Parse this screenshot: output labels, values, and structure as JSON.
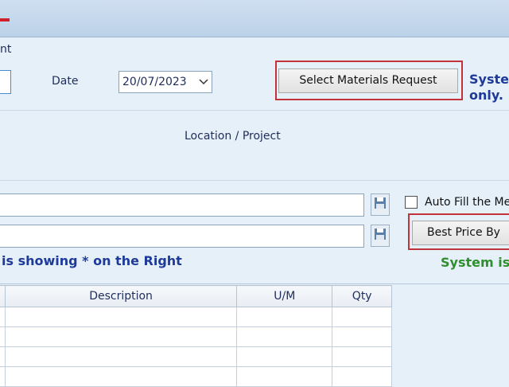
{
  "header_text": {
    "partial_label": "nt",
    "date_label": "Date",
    "date_value": "20/07/2023",
    "select_materials_button": "Select Materials Request",
    "system_note_line1": "Syste",
    "system_note_line2": "only."
  },
  "location": {
    "label": "Location / Project"
  },
  "fields": {
    "auto_fill_label": "Auto Fill the Me",
    "best_price_button": "Best Price By",
    "showing_note": "is showing * on the Right",
    "system_note_green": "System is"
  },
  "grid": {
    "columns": [
      "",
      "Description",
      "U/M",
      "Qty"
    ],
    "rows": [
      [
        "",
        "",
        "",
        ""
      ],
      [
        "",
        "",
        "",
        ""
      ],
      [
        "",
        "",
        "",
        ""
      ],
      [
        "",
        "",
        "",
        ""
      ]
    ]
  },
  "colors": {
    "background": "#e6f0f8",
    "highlight_border": "#c0333a",
    "note_blue": "#1e3a9a",
    "note_green": "#2f8f2f"
  },
  "icons": {
    "save": "floppy-disk-icon",
    "dropdown": "chevron-down-icon"
  }
}
